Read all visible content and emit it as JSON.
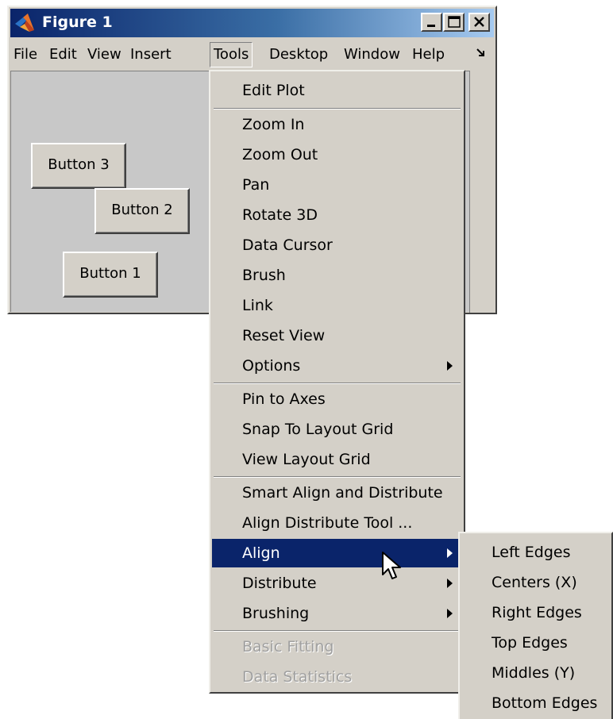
{
  "window": {
    "title": "Figure 1",
    "icon": "matlab-logo-icon"
  },
  "menubar": {
    "items": [
      "File",
      "Edit",
      "View",
      "Insert",
      "Tools",
      "Desktop",
      "Window",
      "Help"
    ],
    "open_item": "Tools",
    "overflow_icon": "chevron-down-right-icon"
  },
  "figure": {
    "buttons": [
      {
        "label": "Button 3"
      },
      {
        "label": "Button 2"
      },
      {
        "label": "Button 1"
      }
    ]
  },
  "tools_menu": {
    "items": [
      {
        "label": "Edit Plot"
      },
      {
        "label": "Zoom In"
      },
      {
        "label": "Zoom Out"
      },
      {
        "label": "Pan"
      },
      {
        "label": "Rotate 3D"
      },
      {
        "label": "Data Cursor"
      },
      {
        "label": "Brush"
      },
      {
        "label": "Link"
      },
      {
        "label": "Reset View"
      },
      {
        "label": "Options",
        "submenu": true
      },
      {
        "label": "Pin to Axes"
      },
      {
        "label": "Snap To Layout Grid"
      },
      {
        "label": "View Layout Grid"
      },
      {
        "label": "Smart Align and Distribute"
      },
      {
        "label": "Align Distribute Tool ..."
      },
      {
        "label": "Align",
        "submenu": true,
        "highlighted": true
      },
      {
        "label": "Distribute",
        "submenu": true
      },
      {
        "label": "Brushing",
        "submenu": true
      },
      {
        "label": "Basic Fitting",
        "disabled": true
      },
      {
        "label": "Data Statistics",
        "disabled": true
      }
    ]
  },
  "align_submenu": {
    "items": [
      {
        "label": "Left Edges"
      },
      {
        "label": "Centers (X)"
      },
      {
        "label": "Right Edges"
      },
      {
        "label": "Top Edges"
      },
      {
        "label": "Middles (Y)"
      },
      {
        "label": "Bottom Edges"
      }
    ]
  },
  "colors": {
    "menu_bg": "#d4d0c8",
    "highlight": "#0a246a",
    "titlebar_start": "#0a246a",
    "titlebar_end": "#a6caf0"
  }
}
